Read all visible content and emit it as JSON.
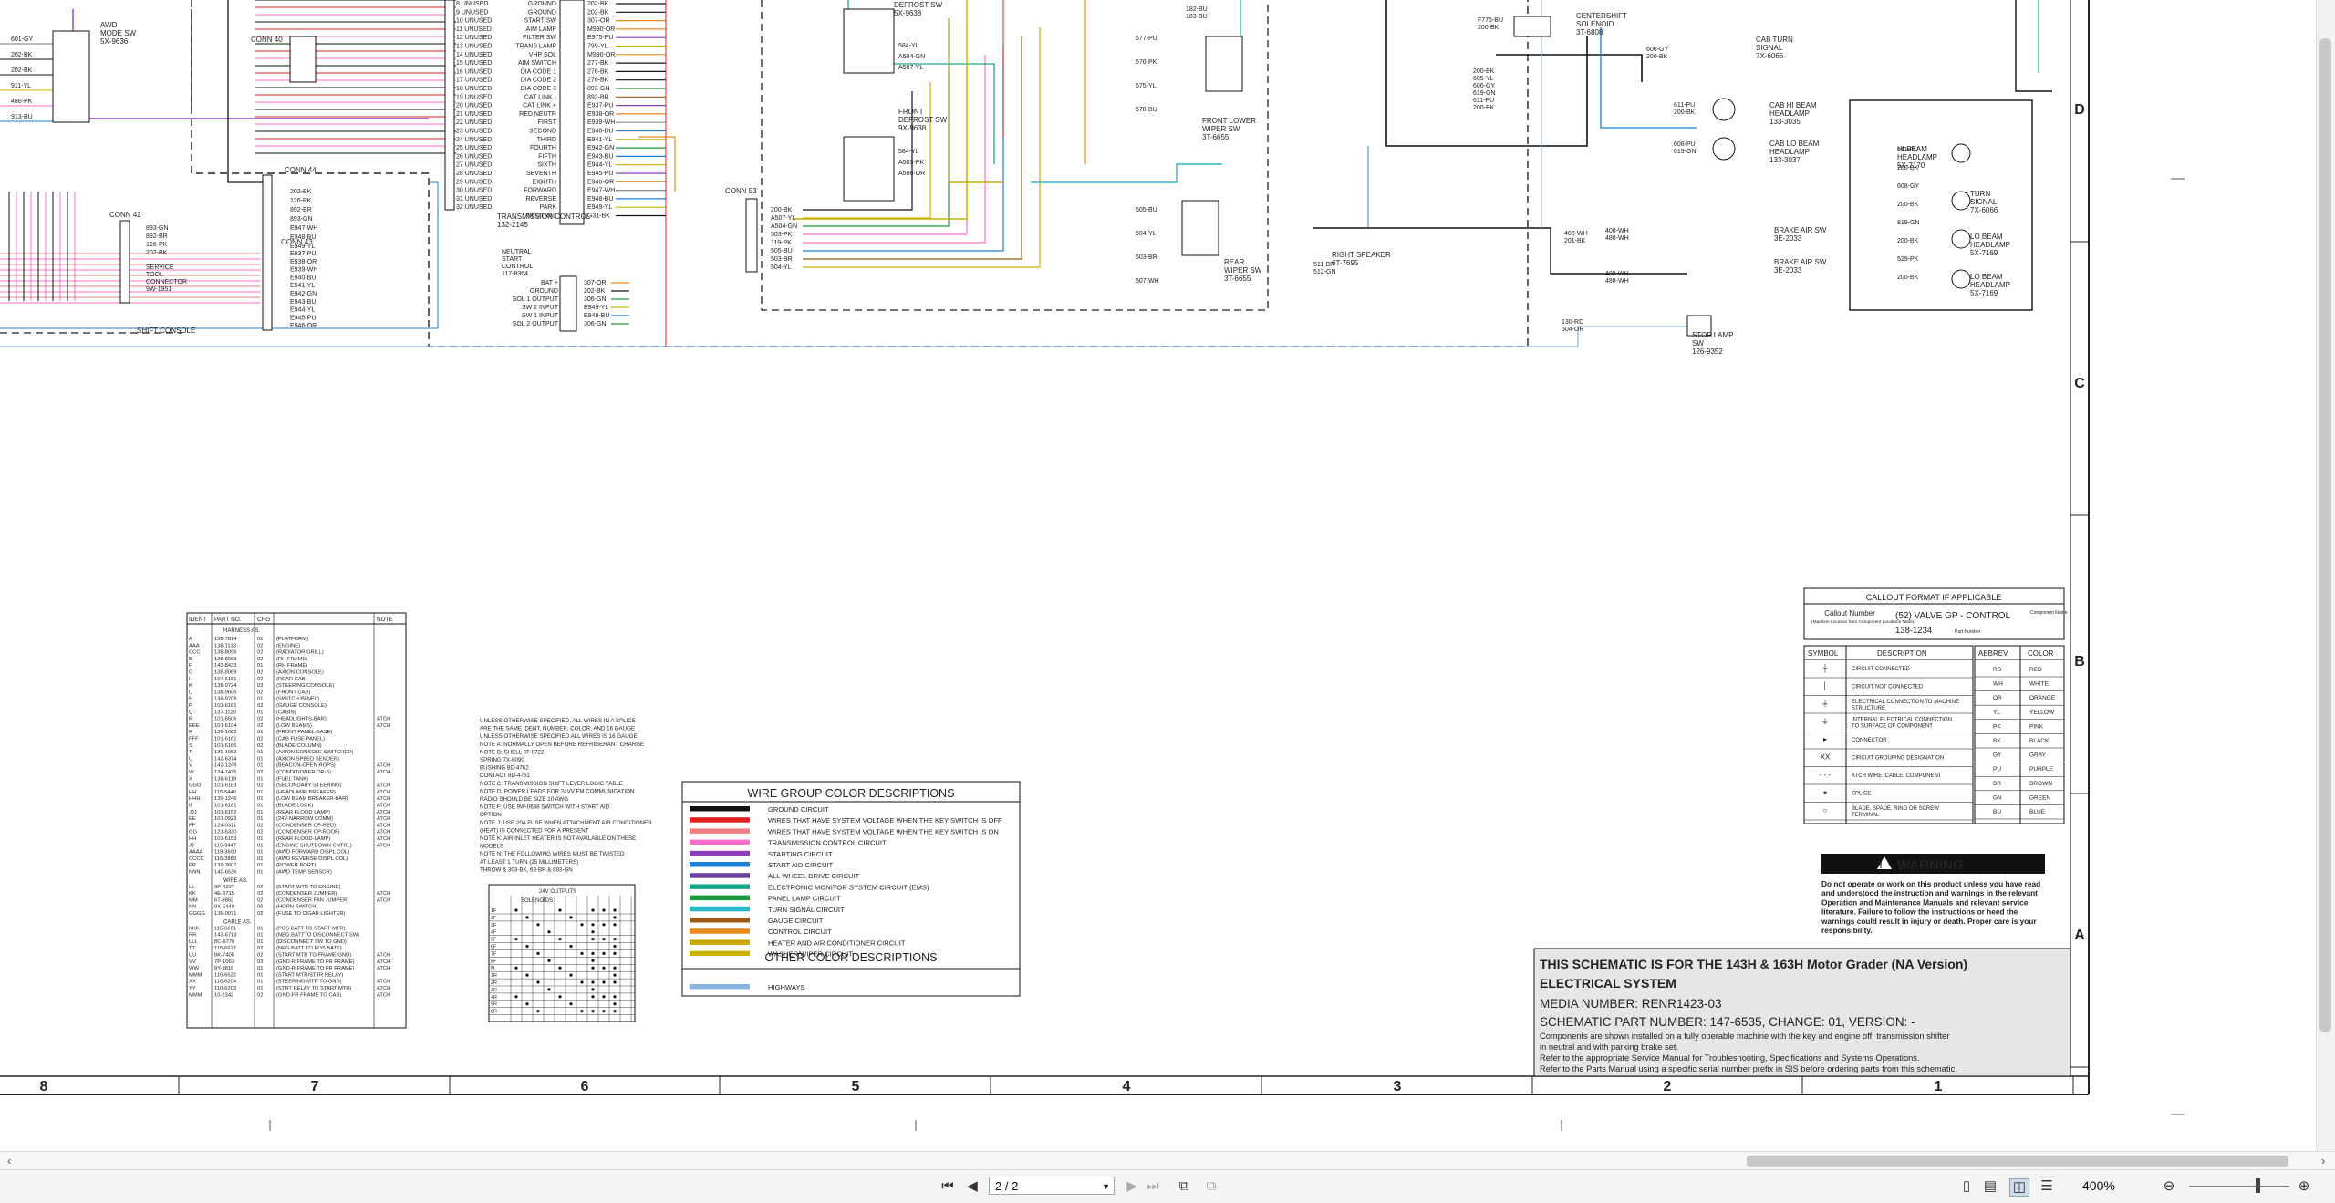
{
  "viewer": {
    "page_indicator": "2 / 2",
    "zoom": "400%"
  },
  "schematic": {
    "grid_columns": [
      "8",
      "7",
      "6",
      "5",
      "4",
      "3",
      "2",
      "1"
    ],
    "grid_rows": [
      "D",
      "C",
      "B",
      "A"
    ],
    "connectors": {
      "conn40": "CONN 40",
      "conn44": "CONN 44",
      "conn42": "CONN 42",
      "conn43": "CONN 43",
      "conn53": "CONN 53",
      "awd": "AWD\nMODE SW\n5X-9636",
      "service_tool": "SERVICE\nTOOL\nCONNECTOR\n9W-1951",
      "shift_console": "SHIFT CONSOLE",
      "transmission_control": "TRANSMISSION CONTROL\n132-2145",
      "neutral_start": "NEUTRAL\nSTART\nCONTROL\n117-8364",
      "front_defrost_top": "DEFROST SW\n5X-9638",
      "front_defrost": "FRONT\nDEFROST SW\n9X-9638",
      "front_lower_wiper": "FRONT LOWER\nWIPER SW\n3T-6655",
      "rear_wiper": "REAR\nWIPER SW\n3T-6655",
      "centershift": "CENTERSHIFT\nSOLENOID\n3T-6808",
      "cab_turn": "CAB TURN\nSIGNAL\n7X-6066",
      "cab_hi": "CAB HI BEAM\nHEADLAMP\n133-3035",
      "cab_lo": "CAB LO BEAM\nHEADLAMP\n133-3037",
      "hi_beam": "HI BEAM\nHEADLAMP\n5X-7170",
      "turn_signal": "TURN\nSIGNAL\n7X-6066",
      "lo_beam_1": "LO BEAM\nHEADLAMP\n5X-7169",
      "lo_beam_2": "LO BEAM\nHEADLAMP\n5X-7169",
      "right_speaker": "RIGHT SPEAKER\n6T-7695",
      "brake_air_1": "BRAKE AIR SW\n3E-2033",
      "brake_air_2": "BRAKE AIR SW\n3E-2033",
      "stop_lamp": "STOP LAMP\nSW\n126-9352"
    },
    "conn40_wires": [
      "UNUSED",
      "UNUSED",
      "UNUSED",
      "UNUSED",
      "UNUSED",
      "UNUSED",
      "UNUSED",
      "UNUSED",
      "UNUSED",
      "UNUSED",
      "UNUSED",
      "UNUSED",
      "UNUSED",
      "UNUSED",
      "UNUSED",
      "UNUSED",
      "UNUSED",
      "UNUSED",
      "UNUSED",
      "UNUSED",
      "UNUSED",
      "UNUSED",
      "UNUSED",
      "UNUSED",
      "UNUSED"
    ],
    "trans_signals": [
      "GROUND",
      "GROUND",
      "START SW",
      "AIM LAMP",
      "FILTER SW",
      "TRANS LAMP",
      "VHP SOL",
      "AIM SWITCH",
      "DIA CODE 1",
      "DIA CODE 2",
      "DIA CODE 3",
      "CAT LINK -",
      "CAT LINK +",
      "RED NEUTR",
      "FIRST",
      "SECOND",
      "THIRD",
      "FOURTH",
      "FIFTH",
      "SIXTH",
      "SEVENTH",
      "EIGHTH",
      "FORWARD",
      "REVERSE",
      "PARK",
      "NEUTRAL"
    ],
    "trans_wires": [
      "202-BK",
      "202-BK",
      "307-OR",
      "M990-OR",
      "E975-PU",
      "799-YL",
      "M990-OR",
      "277-BK",
      "278-BK",
      "276-BK",
      "893-GN",
      "892-BR",
      "E937-PU",
      "E938-OR",
      "E939-WH",
      "E940-BU",
      "E941-YL",
      "E942-GN",
      "E943-BU",
      "E944-YL",
      "E945-PU",
      "E946-OR",
      "E947-WH",
      "E948-BU",
      "E949-YL",
      "G31-BK"
    ]
  },
  "notes": {
    "lines": [
      "UNLESS OTHERWISE SPECIFIED, ALL WIRES IN A SPLICE",
      "ARE THE SAME IDENT, NUMBER, COLOR, AND 16 GAUGE",
      "UNLESS OTHERWISE SPECIFIED ALL WIRES IS 16 GAUGE",
      "NOTE A: NORMALLY OPEN BEFORE REFRIGERANT CHARGE",
      "NOTE B:  SHELL     8T-8722",
      "            SPRING    7X-6090",
      "            BUSHING   8D-4762",
      "            CONTACT   8D-4761",
      "NOTE C: TRANSMISSION SHIFT LEVER LOGIC TABLE",
      "NOTE D: POWER LEADS FOR 24VV FM COMMUNICATION",
      "   RADIO SHOULD BE SIZE 10 AWG",
      "NOTE F: USE 9W-0638 SWITCH WITH START AID",
      "   OPTION",
      "NOTE J: USE 20A FUSE WHEN ATTACHMENT AIR CONDITIONER",
      "   (HEAT) IS CONNECTED FOR A PRESENT",
      "NOTE K: AIR INLET HEATER IS NOT AVAILABLE ON THESE",
      "   MODELS",
      "NOTE N: THE FOLLOWING WIRES MUST BE TWISTED",
      "   AT LEAST 1 TURN (25 MILLIMETERS)",
      "   THROW & 303-BK, 63-BR & 893-GN"
    ]
  },
  "harness_table": {
    "headers": [
      "IDENT",
      "PART NO.",
      "CHG",
      "",
      "NOTE"
    ],
    "section_harness": "HARNESS AS.",
    "section_wire": "WIRE AS.",
    "section_cable": "CABLE AS.",
    "rows": [
      [
        "A",
        "138-7814",
        "01",
        "(PLATFORM)",
        ""
      ],
      [
        "AAA",
        "138-1133",
        "02",
        "(ENGINE)",
        ""
      ],
      [
        "CCC",
        "138-8096",
        "02",
        "(RADIATOR GRILL)",
        ""
      ],
      [
        "B",
        "138-8063",
        "02",
        "(RH FRAME)",
        ""
      ],
      [
        "F",
        "143-8433",
        "01",
        "(RH FRAME)",
        ""
      ],
      [
        "G",
        "138-8069",
        "02",
        "(AXION CONSOLE)",
        ""
      ],
      [
        "H",
        "107-6161",
        "02",
        "(REAR CAB)",
        ""
      ],
      [
        "K",
        "138-9724",
        "03",
        "(STEERING CONSOLE)",
        ""
      ],
      [
        "L",
        "138-9606",
        "02",
        "(FRONT CAB)",
        ""
      ],
      [
        "N",
        "138-9709",
        "01",
        "(SWITCH PANEL)",
        ""
      ],
      [
        "P",
        "101-6161",
        "02",
        "(GAUGE CONSOLE)",
        ""
      ],
      [
        "Q",
        "137-1120",
        "01",
        "(CABIN)",
        ""
      ],
      [
        "R",
        "101-6506",
        "02",
        "(HEADLIGHTS-BAR)",
        "ATCH"
      ],
      [
        "EEE",
        "101-6194",
        "02",
        "(LOW BEAMS)",
        "ATCH"
      ],
      [
        "R",
        "139-1063",
        "01",
        "(FRONT PANEL-BASE)",
        ""
      ],
      [
        "FFF",
        "101-6161",
        "02",
        "(CAB FUSE PANEL)",
        ""
      ],
      [
        "S",
        "101-6166",
        "02",
        "(BLADE COLUMN)",
        ""
      ],
      [
        "T",
        "139-1062",
        "01",
        "(AXION CONSOLE SWITCHED)",
        ""
      ],
      [
        "U",
        "142-6374",
        "01",
        "(AXION SPEED SENDER)",
        ""
      ],
      [
        "V",
        "142-1249",
        "01",
        "(BEACON-OPEN ROPS)",
        "ATCH"
      ],
      [
        "W",
        "124-1425",
        "02",
        "(CONDITIONER OP-S)",
        "ATCH"
      ],
      [
        "X",
        "138-6119",
        "01",
        "(FUEL TANK)",
        ""
      ],
      [
        "GGG",
        "101-6163",
        "02",
        "(SECONDARY STEERING)",
        "ATCH"
      ],
      [
        "HH",
        "115-5446",
        "01",
        "(HEADLAMP BREAKER)",
        "ATCH"
      ],
      [
        "HHH",
        "139-1246",
        "01",
        "(LOW BEAM BREAKER-BAR)",
        "ATCH"
      ],
      [
        "II",
        "101-6161",
        "01",
        "(BLADE LOCK)",
        "ATCH"
      ],
      [
        "JJJ",
        "101-6152",
        "01",
        "(REAR FLOOD LAMP)",
        "ATCH"
      ],
      [
        "EE",
        "101-0923",
        "01",
        "(24V-NARROW COMM)",
        "ATCH"
      ],
      [
        "FF",
        "124-0311",
        "02",
        "(CONDENSER OP-RED)",
        "ATCH"
      ],
      [
        "GG",
        "123-6330",
        "02",
        "(CONDENSER OP-ROOF)",
        "ATCH"
      ],
      [
        "HH",
        "101-6153",
        "01",
        "(REAR FLOOD-LAMP)",
        "ATCH"
      ],
      [
        "JJ",
        "116-9447",
        "01",
        "(ENGINE SHUTDOWN CNTRL)",
        "ATCH"
      ],
      [
        "AAAA",
        "119-3600",
        "01",
        "(AWD FORWARD DISPL COL)",
        ""
      ],
      [
        "CCCC",
        "116-3889",
        "01",
        "(AWD REVERSE DISPL COL)",
        ""
      ],
      [
        "PP",
        "139-3607",
        "01",
        "(POWER PORT)",
        ""
      ],
      [
        "NNN",
        "140-6536",
        "01",
        "(AWD TEMP SENSOR)",
        ""
      ],
      [
        "LL",
        "9P-4227",
        "07",
        "(START WTR TO ENGINE)",
        ""
      ],
      [
        "KK",
        "4E-8715",
        "02",
        "(CONDENSER JUMPER)",
        "ATCH"
      ],
      [
        "MM",
        "6T-8862",
        "02",
        "(CONDENSER FAN JUMPER)",
        "ATCH"
      ],
      [
        "NN",
        "9X-5440",
        "06",
        "(HORN SWITCH)",
        ""
      ],
      [
        "GGGG",
        "136-0071",
        "02",
        "(FUSE TO CIGAR LIGHTER)",
        ""
      ],
      [
        "KKK",
        "115-6691",
        "01",
        "(POS BATT TO START MTR)",
        ""
      ],
      [
        "RR",
        "143-6713",
        "01",
        "(NEG BATTTO DISCONNECT SW)",
        ""
      ],
      [
        "LLL",
        "8C-6770",
        "01",
        "(DISCONNECT SW TO GND)",
        ""
      ],
      [
        "TT",
        "115-6627",
        "02",
        "(NEG BATT TO POS BATT)",
        ""
      ],
      [
        "UU",
        "8K-7405",
        "02",
        "(START MTR TO FRAME GND)",
        "ATCH"
      ],
      [
        "VV",
        "7P-1063",
        "03",
        "(GND-R FRAME TO FR FRAME)",
        "ATCH"
      ],
      [
        "WW",
        "9Y-3816",
        "01",
        "(GND-R FRAME TO FR FRAME)",
        "ATCH"
      ],
      [
        "MMM",
        "110-6522",
        "01",
        "(START MTR/STTR RELAY)",
        ""
      ],
      [
        "XX",
        "110-6204",
        "01",
        "(STEERING MTR TO GND)",
        "ATCH"
      ],
      [
        "YY",
        "110-6203",
        "01",
        "(STRT RELAY TO START MTR)",
        "ATCH"
      ],
      [
        "MMM",
        "10-2342",
        "02",
        "(GND-FR FRAME TO CAB)",
        "ATCH"
      ]
    ]
  },
  "logic_table": {
    "title": "24V OUTPUTS",
    "sub": "SOLENOIDS",
    "gears": [
      "1F",
      "2F",
      "3F",
      "4F",
      "5F",
      "6F",
      "7F",
      "8F",
      "N",
      "1R",
      "2R",
      "3R",
      "4R",
      "5R",
      "6R"
    ]
  },
  "wire_colors": {
    "title": "WIRE GROUP COLOR DESCRIPTIONS",
    "items": [
      {
        "color": "#111111",
        "label": "GROUND CIRCUIT"
      },
      {
        "color": "#e02020",
        "label": "WIRES THAT HAVE SYSTEM VOLTAGE WHEN THE KEY SWITCH IS OFF"
      },
      {
        "color": "#f07f7f",
        "label": "WIRES THAT HAVE SYSTEM VOLTAGE WHEN THE KEY SWITCH IS ON"
      },
      {
        "color": "#ff6fc8",
        "label": "TRANSMISSION CONTROL CIRCUIT"
      },
      {
        "color": "#8a3fb8",
        "label": "STARTING CIRCUIT"
      },
      {
        "color": "#1b7fd8",
        "label": "START AID CIRCUIT"
      },
      {
        "color": "#6a3fa0",
        "label": "ALL WHEEL DRIVE CIRCUIT"
      },
      {
        "color": "#1aa88a",
        "label": "ELECTRONIC MONITOR SYSTEM CIRCUIT (EMS)"
      },
      {
        "color": "#1a9a3a",
        "label": "PANEL LAMP CIRCUIT"
      },
      {
        "color": "#2db8c8",
        "label": "TURN SIGNAL CIRCUIT"
      },
      {
        "color": "#9b5a1a",
        "label": "GAUGE CIRCUIT"
      },
      {
        "color": "#e88a20",
        "label": "CONTROL CIRCUIT"
      },
      {
        "color": "#c8a800",
        "label": "HEATER AND AIR CONDITIONER CIRCUIT"
      },
      {
        "color": "#c9b200",
        "label": "WASHER/WIPER CIRCUIT"
      }
    ],
    "other_title": "OTHER COLOR DESCRIPTIONS",
    "other_items": [
      {
        "color": "#8ab4e0",
        "label": "HIGHWAYS"
      }
    ]
  },
  "callout": {
    "title": "CALLOUT FORMAT IF APPLICABLE",
    "callout_number": "Callout Number",
    "callout_hint": "(Machine Location from Component Locations Table)",
    "example": "(52) VALVE GP - CONTROL",
    "component_name": "Component Name",
    "part_example": "138-1234",
    "part_number": "Part Number"
  },
  "symbols": {
    "headers": [
      "SYMBOL",
      "DESCRIPTION"
    ],
    "rows": [
      "CIRCUIT CONNECTED",
      "CIRCUIT NOT CONNECTED",
      "ELECTRICAL CONNECTION TO MACHINE STRUCTURE",
      "INTERNAL ELECTRICAL CONNECTION TO SURFACE OF COMPONENT",
      "CONNECTOR",
      "CIRCUIT GROUPING DESIGNATION",
      "ATCH WIRE, CABLE, COMPONENT",
      "SPLICE",
      "BLADE, SPADE, RING OR SCREW TERMINAL"
    ]
  },
  "abbrev": {
    "headers": [
      "ABBREV",
      "COLOR"
    ],
    "rows": [
      [
        "RD",
        "RED"
      ],
      [
        "WH",
        "WHITE"
      ],
      [
        "OR",
        "ORANGE"
      ],
      [
        "YL",
        "YELLOW"
      ],
      [
        "PK",
        "PINK"
      ],
      [
        "BK",
        "BLACK"
      ],
      [
        "GY",
        "GRAY"
      ],
      [
        "PU",
        "PURPLE"
      ],
      [
        "BR",
        "BROWN"
      ],
      [
        "GN",
        "GREEN"
      ],
      [
        "BU",
        "BLUE"
      ]
    ]
  },
  "warning": {
    "title": "WARNING",
    "text": "Do not operate or work on this product unless you have read and understood the instruction and warnings in the relevant Operation and Maintenance Manuals and relevant service literature. Failure to follow the instructions or heed the warnings could result in injury or death. Proper care is your responsibility."
  },
  "title_block": {
    "line1": "THIS SCHEMATIC IS FOR THE 143H & 163H Motor Grader (NA Version)",
    "line2": "ELECTRICAL SYSTEM",
    "line3": "MEDIA NUMBER: RENR1423-03",
    "line4": "SCHEMATIC PART NUMBER: 147-6535, CHANGE: 01, VERSION: -",
    "line5": "Components are shown installed on a fully operable machine with the key and engine off, transmission shifter",
    "line6": "in neutral and with parking brake set.",
    "line7": "Refer to the appropriate Service Manual for Troubleshooting, Specifications and Systems Operations.",
    "line8": "Refer to the Parts Manual using a specific serial number prefix in SIS before ordering parts from this schematic."
  }
}
